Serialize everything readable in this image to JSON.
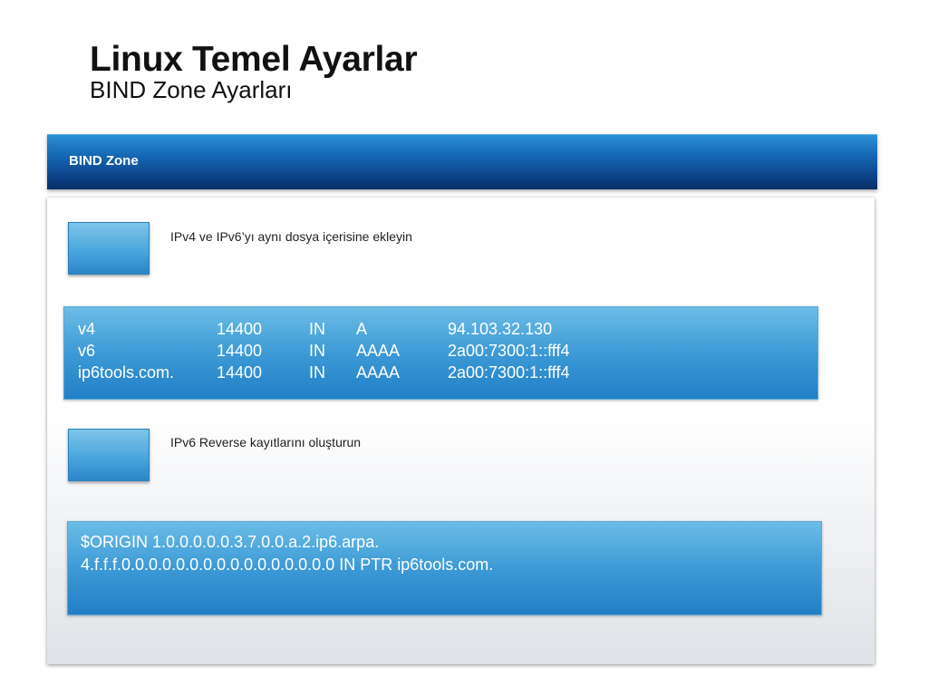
{
  "slide": {
    "title": "Linux Temel Ayarlar",
    "subtitle": "BIND Zone Ayarları"
  },
  "header": {
    "label": "BIND Zone"
  },
  "section1": {
    "text": "IPv4 ve IPv6’yı aynı dosya içerisine ekleyin",
    "records": [
      [
        "v4",
        "14400",
        "IN",
        "A",
        "94.103.32.130"
      ],
      [
        "v6",
        "14400",
        "IN",
        "AAAA",
        "2a00:7300:1::fff4"
      ],
      [
        "ip6tools.com.",
        "14400",
        "IN",
        "AAAA",
        "2a00:7300:1::fff4"
      ]
    ]
  },
  "section2": {
    "text": "IPv6 Reverse kayıtlarını oluşturun",
    "lines": [
      "$ORIGIN 1.0.0.0.0.0.3.7.0.0.a.2.ip6.arpa.",
      "4.f.f.f.0.0.0.0.0.0.0.0.0.0.0.0.0.0.0.0 IN PTR ip6tools.com."
    ]
  },
  "colors": {
    "header_dark": "#0b3f83",
    "header_light": "#2a8fd6",
    "box_light": "#6bbde6",
    "box_dark": "#217fc6"
  }
}
